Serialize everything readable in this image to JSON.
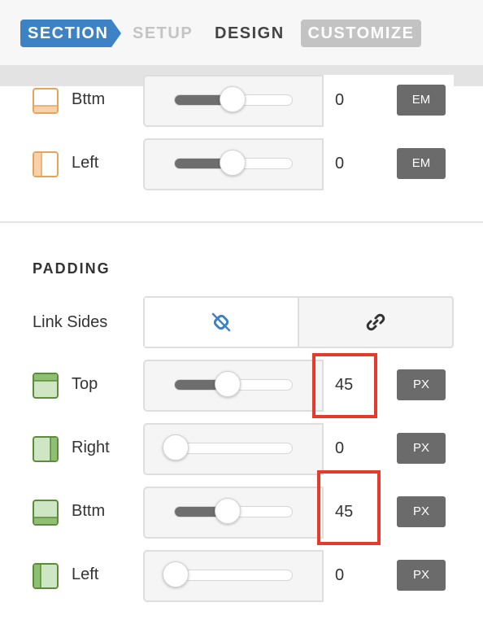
{
  "tabs": {
    "section": "SECTION",
    "setup": "SETUP",
    "design": "DESIGN",
    "customize": "CUSTOMIZE"
  },
  "margin_rows": [
    {
      "label": "Bttm",
      "value": "0",
      "unit": "EM",
      "slider_fraction": 0.5,
      "icon": "border-bottom-icon"
    },
    {
      "label": "Left",
      "value": "0",
      "unit": "EM",
      "slider_fraction": 0.5,
      "icon": "border-left-icon"
    }
  ],
  "padding": {
    "heading": "PADDING",
    "link_sides_label": "Link Sides",
    "link_options": [
      "unlink-icon",
      "link-icon"
    ],
    "rows": [
      {
        "label": "Top",
        "value": "45",
        "unit": "PX",
        "slider_fraction": 0.45,
        "icon": "padding-top-icon"
      },
      {
        "label": "Right",
        "value": "0",
        "unit": "PX",
        "slider_fraction": 0.0,
        "icon": "padding-right-icon"
      },
      {
        "label": "Bttm",
        "value": "45",
        "unit": "PX",
        "slider_fraction": 0.45,
        "icon": "padding-bottom-icon"
      },
      {
        "label": "Left",
        "value": "0",
        "unit": "PX",
        "slider_fraction": 0.0,
        "icon": "padding-left-icon"
      }
    ]
  },
  "colors": {
    "accent": "#3d82c4",
    "highlight": "#e53b2c",
    "margin_icon": "#e8a35a",
    "padding_icon": "#5b8c3a"
  }
}
